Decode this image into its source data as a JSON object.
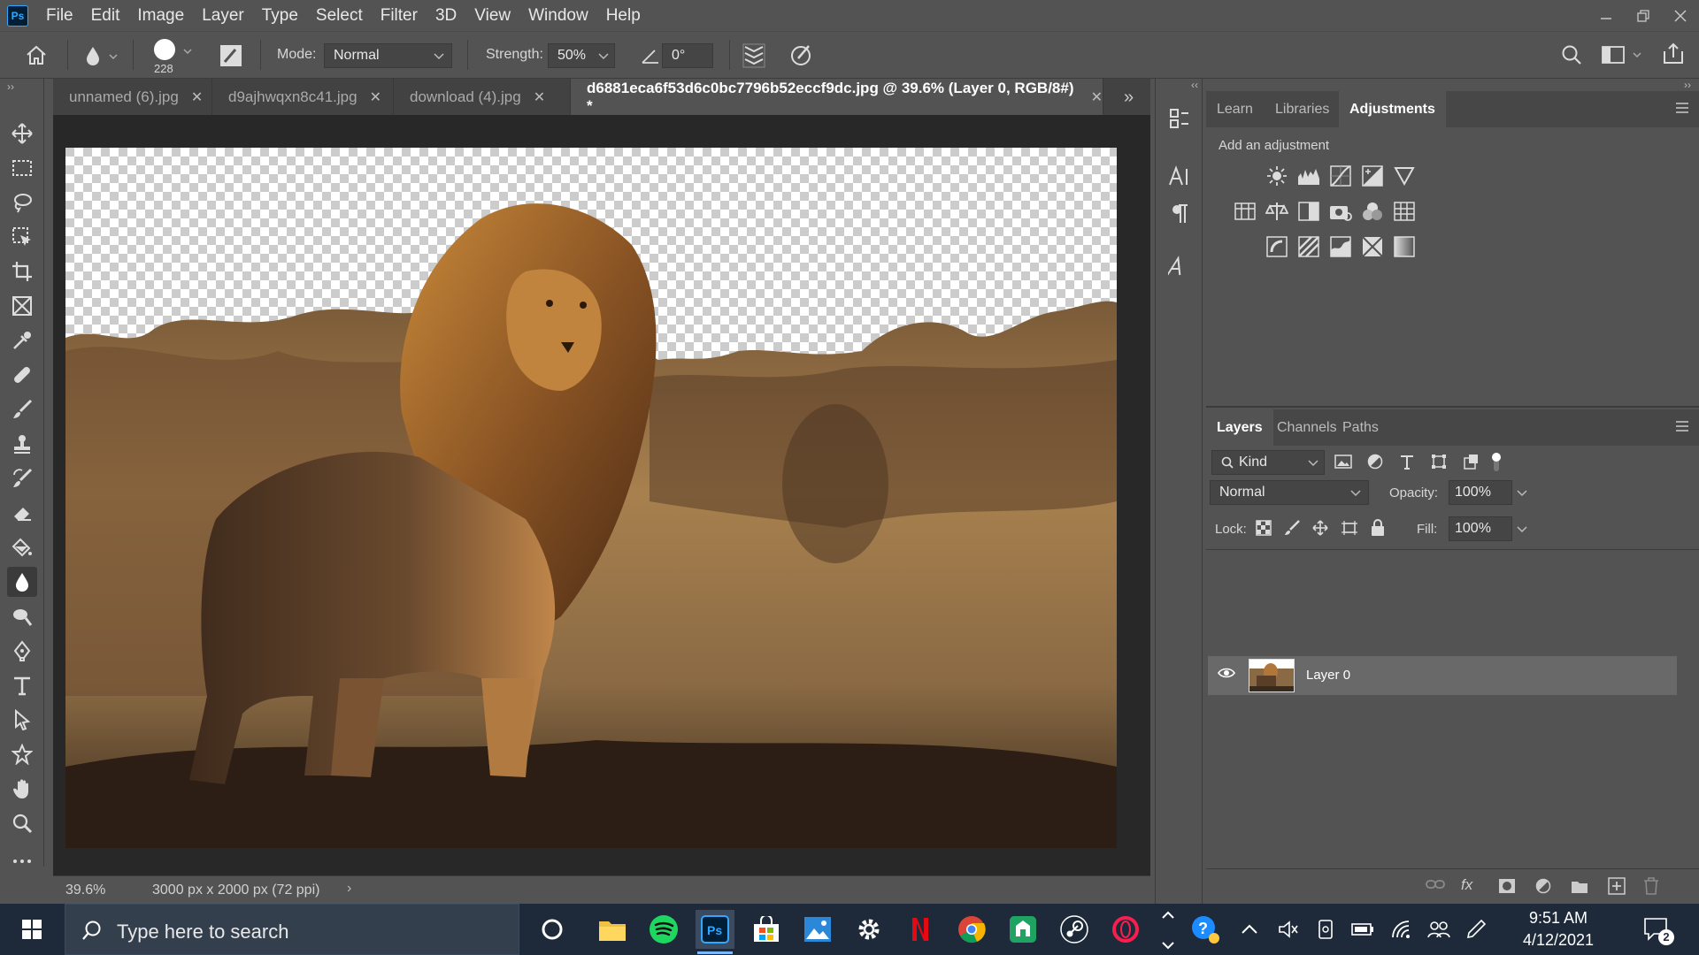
{
  "app": {
    "logo_text": "Ps"
  },
  "menu": [
    "File",
    "Edit",
    "Image",
    "Layer",
    "Type",
    "Select",
    "Filter",
    "3D",
    "View",
    "Window",
    "Help"
  ],
  "options": {
    "brush_size": "228",
    "mode_label": "Mode:",
    "mode_value": "Normal",
    "strength_label": "Strength:",
    "strength_value": "50%",
    "angle_value": "0°"
  },
  "tabs": [
    {
      "label": "unnamed (6).jpg",
      "active": false
    },
    {
      "label": "d9ajhwqxn8c41.jpg",
      "active": false
    },
    {
      "label": "download (4).jpg",
      "active": false
    },
    {
      "label": "d6881eca6f53d6c0bc7796b52eccf9dc.jpg @ 39.6% (Layer 0, RGB/8#) *",
      "active": true
    }
  ],
  "status": {
    "zoom": "39.6%",
    "doc_info": "3000 px x 2000 px (72 ppi)"
  },
  "adjustments_panel": {
    "tabs": [
      "Learn",
      "Libraries",
      "Adjustments"
    ],
    "active_tab": "Adjustments",
    "heading": "Add an adjustment"
  },
  "layers_panel": {
    "tabs": [
      "Layers",
      "Channels",
      "Paths"
    ],
    "active_tab": "Layers",
    "filter_kind": "Kind",
    "blend_mode": "Normal",
    "opacity_label": "Opacity:",
    "opacity_value": "100%",
    "lock_label": "Lock:",
    "fill_label": "Fill:",
    "fill_value": "100%",
    "layers": [
      {
        "name": "Layer 0",
        "visible": true,
        "selected": true
      }
    ]
  },
  "taskbar": {
    "search_placeholder": "Type here to search",
    "time": "9:51 AM",
    "date": "4/12/2021",
    "notification_count": "2"
  },
  "colors": {
    "accent": "#31a8ff",
    "panel_bg": "#535353",
    "workspace_bg": "#282828"
  }
}
